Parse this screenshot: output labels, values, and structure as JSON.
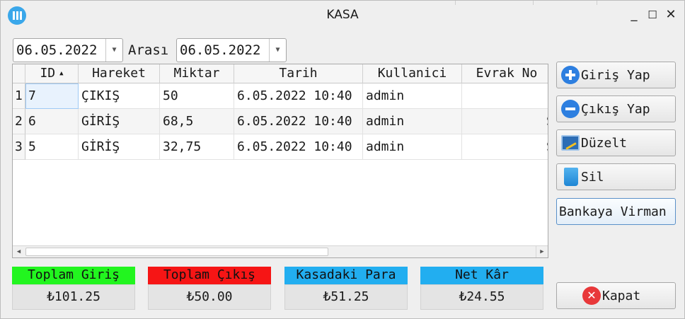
{
  "window": {
    "title": "KASA",
    "app_icon": "barcode-icon",
    "controls": {
      "minimize": "_",
      "maximize": "☐",
      "close": "✕"
    }
  },
  "filter": {
    "start_date": "06.05.2022",
    "separator": "Arası",
    "end_date": "06.05.2022"
  },
  "table": {
    "columns": [
      "ID",
      "Hareket",
      "Miktar",
      "Tarih",
      "Kullanici",
      "Evrak No",
      ""
    ],
    "sort_column": "ID",
    "rows": [
      {
        "num": "1",
        "id": "7",
        "hareket": "ÇIKIŞ",
        "miktar": "50",
        "tarih": "6.05.2022 10:40",
        "kullanici": "admin",
        "evrak": "",
        "extra": ""
      },
      {
        "num": "2",
        "id": "6",
        "hareket": "GİRİŞ",
        "miktar": "68,5",
        "tarih": "6.05.2022 10:40",
        "kullanici": "admin",
        "evrak": "",
        "extra": "S"
      },
      {
        "num": "3",
        "id": "5",
        "hareket": "GİRİŞ",
        "miktar": "32,75",
        "tarih": "6.05.2022 10:40",
        "kullanici": "admin",
        "evrak": "",
        "extra": "S"
      }
    ]
  },
  "buttons": {
    "giris": "Giriş Yap",
    "cikis": "Çıkış Yap",
    "duzelt": "Düzelt",
    "sil": "Sil",
    "virman": "Bankaya Virman",
    "kapat": "Kapat"
  },
  "summary": [
    {
      "label": "Toplam Giriş",
      "value": "₺101.25",
      "color": "#22f51f"
    },
    {
      "label": "Toplam Çıkış",
      "value": "₺50.00",
      "color": "#f61515"
    },
    {
      "label": "Kasadaki Para",
      "value": "₺51.25",
      "color": "#22aef0"
    },
    {
      "label": "Net Kâr",
      "value": "₺24.55",
      "color": "#22aef0"
    }
  ]
}
